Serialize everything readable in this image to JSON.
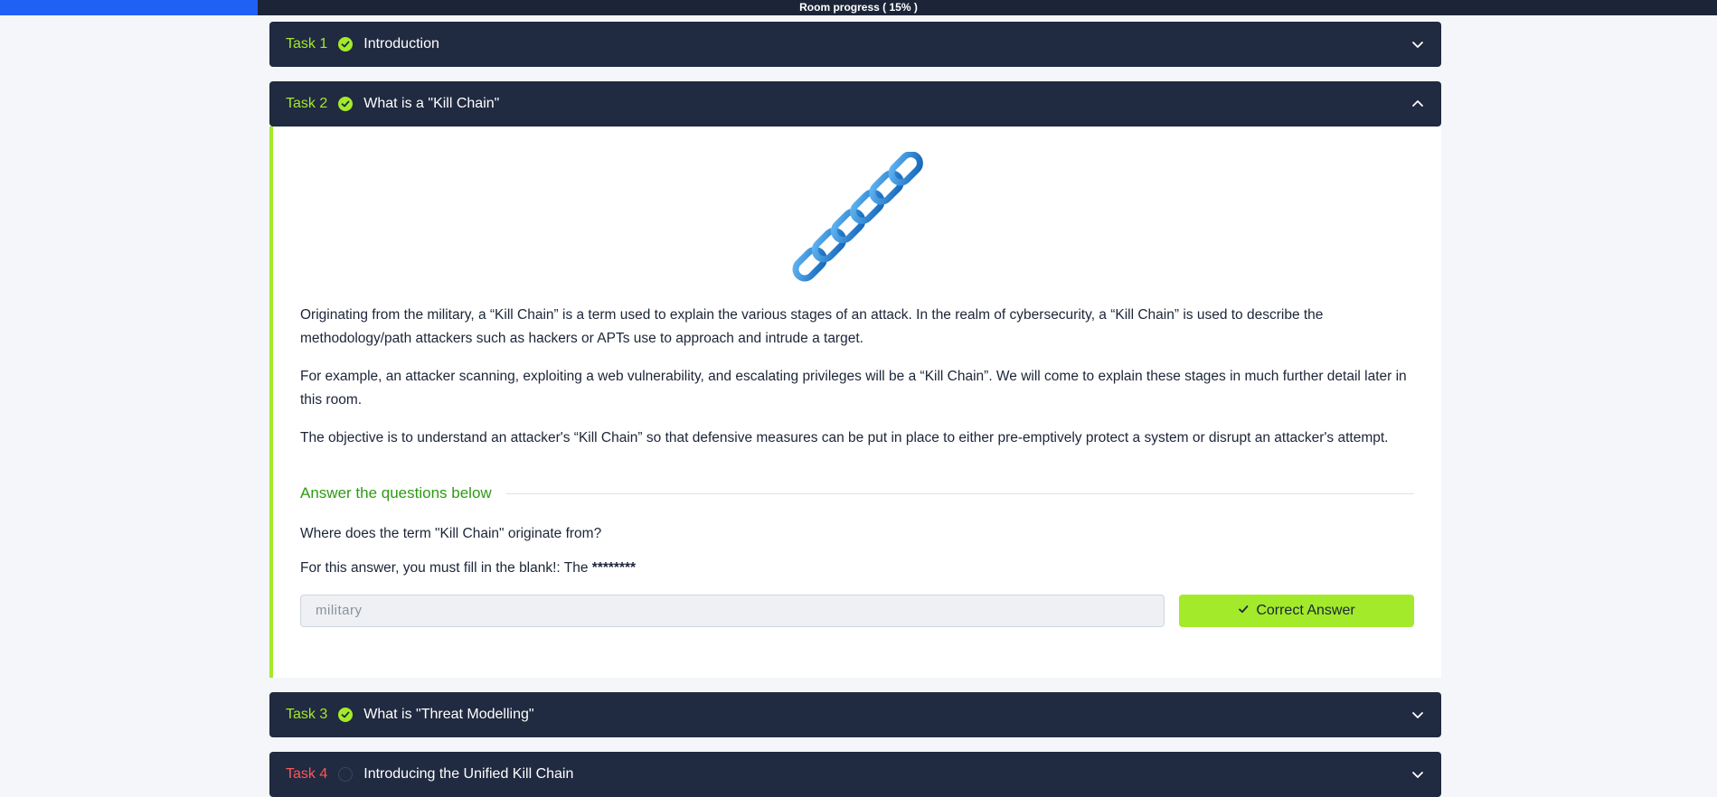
{
  "progress": {
    "label": "Room progress ( 15% )",
    "percent": 15
  },
  "colors": {
    "accent": "#a3ea2a",
    "header_bg": "#202a40",
    "todo": "#ff575a",
    "progress_fill": "#2160f5"
  },
  "tasks": [
    {
      "number": "Task 1",
      "title": "Introduction",
      "status": "done"
    },
    {
      "number": "Task 2",
      "title": "What is a \"Kill Chain\"",
      "status": "done"
    },
    {
      "number": "Task 3",
      "title": "What is \"Threat Modelling\"",
      "status": "done"
    },
    {
      "number": "Task 4",
      "title": "Introducing the Unified Kill Chain",
      "status": "todo"
    }
  ],
  "task2_body": {
    "image_icon": "chain-link-icon",
    "paragraphs": [
      "Originating from the military, a “Kill Chain” is a term used to explain the various stages of an attack. In the realm of cybersecurity, a “Kill Chain” is used to describe the methodology/path attackers such as hackers or APTs use to approach and intrude a target.",
      "For example, an attacker scanning, exploiting a web vulnerability, and escalating privileges will be a “Kill Chain”. We will come to explain these stages in much further detail later in this room.",
      "The objective is to understand an attacker's “Kill Chain” so that defensive measures can be put in place to either pre-emptively protect a system or disrupt an attacker's attempt."
    ],
    "questions_heading": "Answer the questions below",
    "question": "Where does the term \"Kill Chain\" originate from?",
    "hint_prefix": "For this answer, you must fill in the blank!: The ",
    "hint_mask": "********",
    "answer_value": "military",
    "answer_button": "Correct Answer"
  }
}
